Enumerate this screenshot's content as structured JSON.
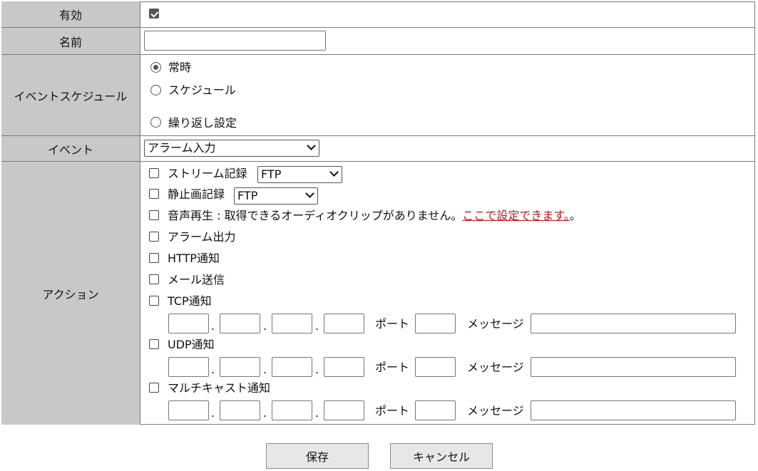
{
  "rows": {
    "enabled": {
      "label": "有効",
      "checked": true
    },
    "name": {
      "label": "名前",
      "value": ""
    },
    "schedule": {
      "label": "イベントスケジュール",
      "options": [
        {
          "label": "常時",
          "selected": true
        },
        {
          "label": "スケジュール",
          "selected": false
        },
        {
          "label": "繰り返し設定",
          "selected": false
        }
      ]
    },
    "event": {
      "label": "イベント",
      "selected": "アラーム入力"
    },
    "action": {
      "label": "アクション",
      "stream_record": {
        "label": "ストリーム記録",
        "select": "FTP",
        "checked": false
      },
      "still_record": {
        "label": "静止画記録",
        "select": "FTP",
        "checked": false
      },
      "audio_play": {
        "label": "音声再生 : 取得できるオーディオクリップがありません。",
        "link": "ここで設定できます。",
        "suffix": "。",
        "checked": false
      },
      "alarm_out": {
        "label": "アラーム出力",
        "checked": false
      },
      "http_notify": {
        "label": "HTTP通知",
        "checked": false
      },
      "mail_send": {
        "label": "メール送信",
        "checked": false
      },
      "tcp_notify": {
        "label": "TCP通知",
        "checked": false
      },
      "udp_notify": {
        "label": "UDP通知",
        "checked": false
      },
      "multicast_notify": {
        "label": "マルチキャスト通知",
        "checked": false
      },
      "port_label": "ポート",
      "message_label": "メッセージ",
      "ip_separator": "."
    }
  },
  "buttons": {
    "save": "保存",
    "cancel": "キャンセル"
  },
  "colors": {
    "label_bg": "#c8c8c8",
    "link": "#b01818",
    "border": "#7a7a7a"
  }
}
